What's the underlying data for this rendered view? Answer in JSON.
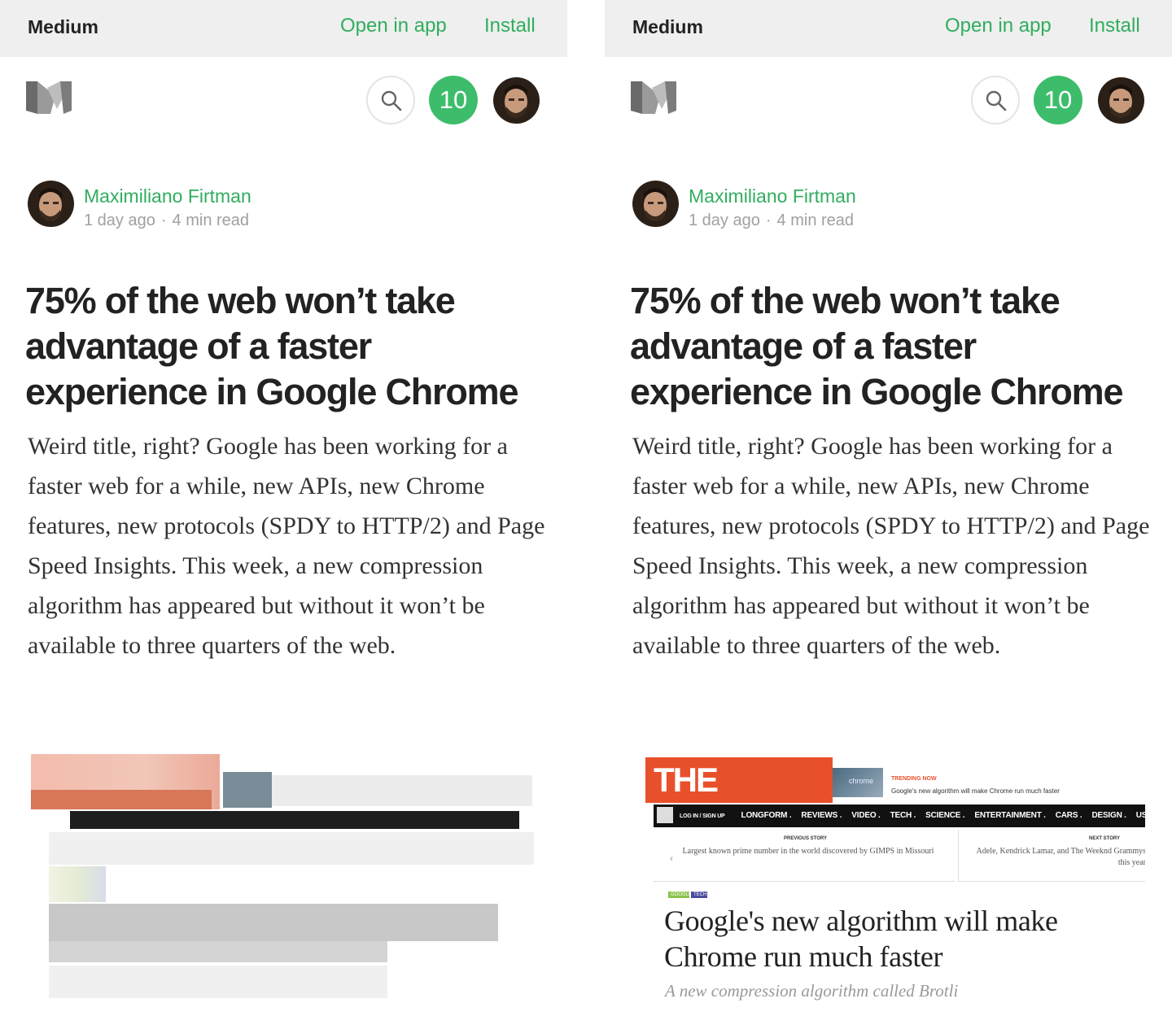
{
  "topbar": {
    "app_name": "Medium",
    "open_in_app": "Open in app",
    "install": "Install"
  },
  "header": {
    "notifications_count": "10"
  },
  "author": {
    "name": "Maximiliano Firtman",
    "time": "1 day ago",
    "separator": "·",
    "read_time": "4 min read"
  },
  "article": {
    "title": "75% of the web won’t take advantage of a faster experience in Google Chrome",
    "body": "Weird title, right? Google has been working for a faster web for a while, new APIs, new Chrome features, new protocols (SPDY to HTTP/2) and Page Speed Insights. This week, a new compression algorithm has appeared but without it won’t be available to three quarters of the web."
  },
  "verge": {
    "logo": "THE VERGE",
    "thumb_label": "chrome",
    "trending_label": "TRENDING NOW",
    "trending_text": "Google's new algorithm will make Chrome run much faster",
    "nav": {
      "login": "LOG IN / SIGN UP",
      "items": [
        "LONGFORM .",
        "REVIEWS .",
        "VIDEO .",
        "TECH .",
        "SCIENCE .",
        "ENTERTAINMENT .",
        "CARS .",
        "DESIGN .",
        "US & WORLD ."
      ]
    },
    "previous": {
      "label": "PREVIOUS STORY",
      "text": "Largest known prime number in the world discovered by GIMPS in Missouri"
    },
    "next": {
      "label": "NEXT STORY",
      "text": "Adele, Kendrick Lamar, and The Weeknd Grammys this year"
    },
    "tags": [
      "GOOGLE",
      "TECH"
    ],
    "headline": "Google's new algorithm will make Chrome run much faster",
    "subhead": "A new compression algorithm called Brotli"
  },
  "colors": {
    "accent": "#2fae5e",
    "badge": "#3dbd6b",
    "verge": "#e8502b",
    "topbar": "#efefef"
  }
}
